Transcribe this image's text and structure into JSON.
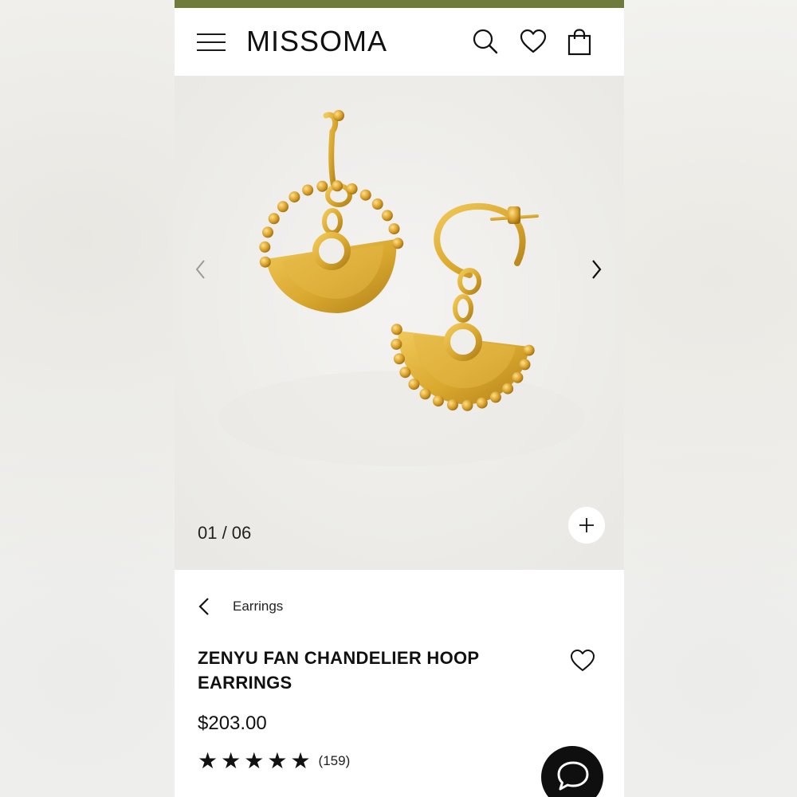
{
  "colors": {
    "top_bar": "#6e7b3a",
    "gold": "#d9a82e",
    "gold_dark": "#b9871a",
    "ink": "#111111"
  },
  "header": {
    "logo": "MISSOMA",
    "icons": [
      "menu-icon",
      "search-icon",
      "heart-icon",
      "bag-icon"
    ]
  },
  "gallery": {
    "counter": "01 / 06",
    "current_image": 1,
    "total_images": 6,
    "icons": [
      "chevron-left-icon",
      "chevron-right-icon",
      "plus-icon"
    ]
  },
  "breadcrumb": {
    "label": "Earrings"
  },
  "product": {
    "title": "ZENYU FAN CHANDELIER HOOP EARRINGS",
    "price": "$203.00",
    "rating_stars": 5,
    "review_count": "(159)"
  },
  "chat": {
    "icon": "chat-bubble-icon"
  }
}
